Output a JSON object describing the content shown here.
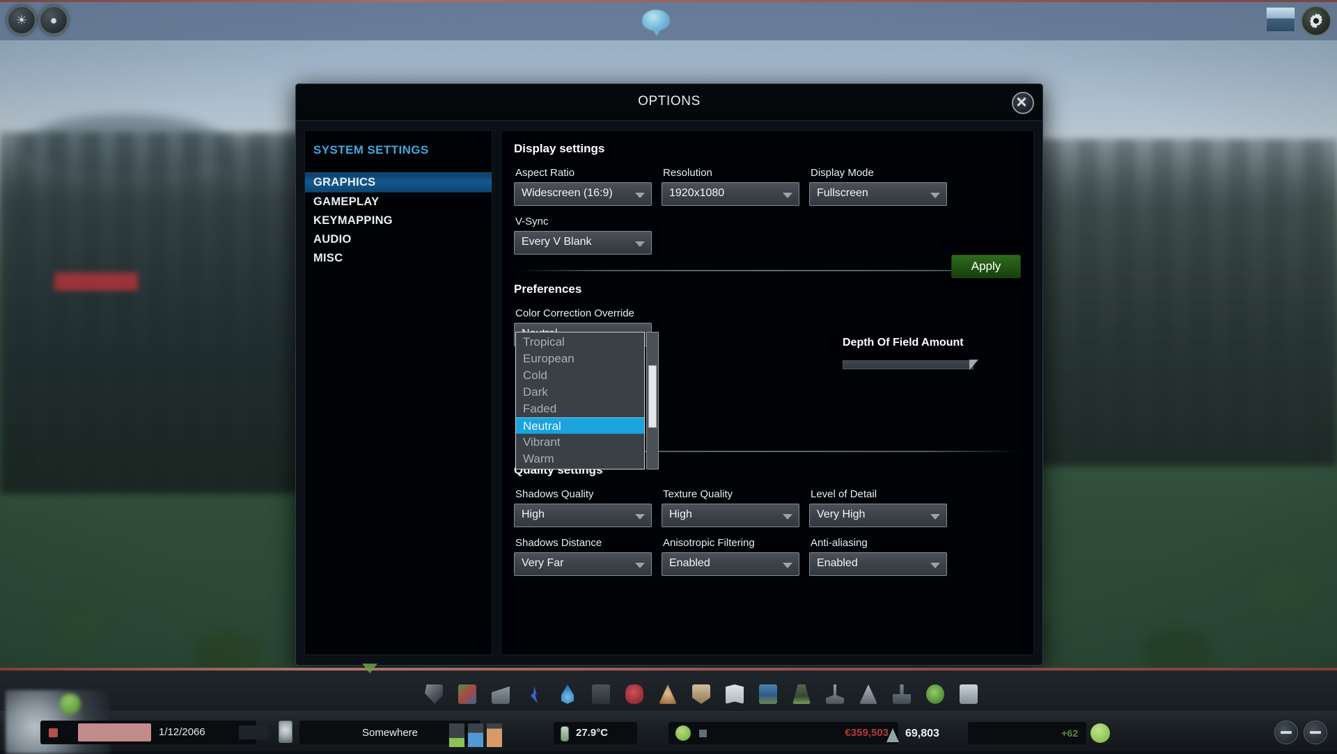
{
  "top_bar": {
    "left_buttons": [
      {
        "name": "disaster-panel-button",
        "glyph": "☸"
      },
      {
        "name": "chirper-button",
        "glyph": "◕"
      }
    ],
    "chirper_icon": "chirper-bird-icon",
    "thumbnail_icon": "city-thumbnail-icon",
    "gear_icon": "gear-icon"
  },
  "dialog": {
    "title": "OPTIONS",
    "close_label": "close-button"
  },
  "sidebar": {
    "heading": "SYSTEM SETTINGS",
    "items": [
      {
        "label": "GRAPHICS",
        "active": true
      },
      {
        "label": "GAMEPLAY",
        "active": false
      },
      {
        "label": "KEYMAPPING",
        "active": false
      },
      {
        "label": "AUDIO",
        "active": false
      },
      {
        "label": "MISC",
        "active": false
      }
    ]
  },
  "display_settings": {
    "title": "Display settings",
    "fields": [
      {
        "label": "Aspect Ratio",
        "value": "Widescreen (16:9)"
      },
      {
        "label": "Resolution",
        "value": "1920x1080"
      },
      {
        "label": "Display Mode",
        "value": "Fullscreen"
      },
      {
        "label": "V-Sync",
        "value": "Every V Blank"
      }
    ],
    "apply_label": "Apply"
  },
  "preferences": {
    "title": "Preferences",
    "color_correction": {
      "label": "Color Correction Override",
      "value": "Neutral",
      "options": [
        {
          "label": "Tropical",
          "selected": false
        },
        {
          "label": "European",
          "selected": false
        },
        {
          "label": "Cold",
          "selected": false
        },
        {
          "label": "Dark",
          "selected": false
        },
        {
          "label": "Faded",
          "selected": false
        },
        {
          "label": "Neutral",
          "selected": true
        },
        {
          "label": "Vibrant",
          "selected": false
        },
        {
          "label": "Warm",
          "selected": false
        }
      ]
    },
    "depth_of_field": {
      "label": "Depth Of Field Amount",
      "percent": 97
    }
  },
  "quality_settings": {
    "title": "Quality settings",
    "fields": [
      {
        "label": "Shadows Quality",
        "value": "High"
      },
      {
        "label": "Texture Quality",
        "value": "High"
      },
      {
        "label": "Level of Detail",
        "value": "Very High"
      },
      {
        "label": "Shadows Distance",
        "value": "Very Far"
      },
      {
        "label": "Anisotropic Filtering",
        "value": "Enabled"
      },
      {
        "label": "Anti-aliasing",
        "value": "Enabled"
      }
    ]
  },
  "hud": {
    "date": "1/12/2066",
    "location": "Somewhere",
    "temperature": "27.9°C",
    "money": "€359,503",
    "population": "69,803",
    "happiness": "+62",
    "toolbar_icons": [
      "bulldoze-icon",
      "districts-icon",
      "roads-icon",
      "electricity-icon",
      "water-icon",
      "garbage-icon",
      "healthcare-icon",
      "fire-icon",
      "police-icon",
      "education-icon",
      "transport-icon",
      "park-icon",
      "unique-building-icon",
      "monument-icon",
      "industry-icon",
      "eco-icon",
      "info-views-icon"
    ]
  },
  "colors": {
    "accent_blue": "#3fa9e0",
    "selection_cyan": "#1ba3dd",
    "apply_green": "#2e6b1d",
    "money_red": "#b4383a",
    "happy_green": "#5a8a3e"
  }
}
